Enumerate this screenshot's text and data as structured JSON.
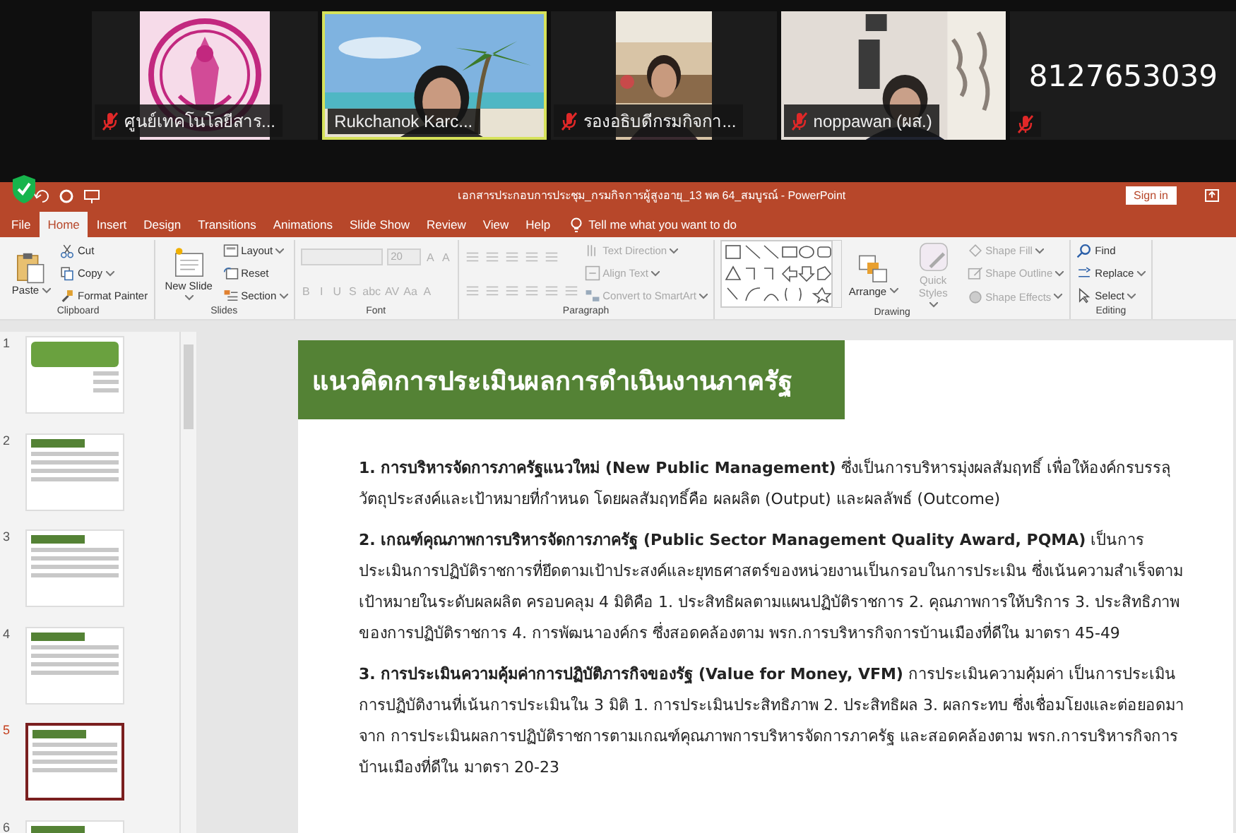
{
  "meeting": {
    "participants": [
      {
        "kind": "logo",
        "name": "ศูนย์เทคโนโลยีสาร...",
        "muted": true,
        "selected": false
      },
      {
        "kind": "video",
        "name": "Rukchanok Karc...",
        "muted": false,
        "selected": true
      },
      {
        "kind": "video",
        "name": "รองอธิบดีกรมกิจกา...",
        "muted": true,
        "selected": false
      },
      {
        "kind": "video",
        "name": "noppawan (ผส.)",
        "muted": true,
        "selected": false
      },
      {
        "kind": "number",
        "name": "8127653039",
        "muted": true,
        "selected": false
      }
    ]
  },
  "powerpoint": {
    "window": {
      "title": "เอกสารประกอบการประชุม_กรมกิจการผู้สูงอายุ_13 พค 64_สมบูรณ์  -  PowerPoint",
      "sign_in": "Sign in"
    },
    "tabs": [
      {
        "label": "File",
        "selected": false
      },
      {
        "label": "Home",
        "selected": true
      },
      {
        "label": "Insert",
        "selected": false
      },
      {
        "label": "Design",
        "selected": false
      },
      {
        "label": "Transitions",
        "selected": false
      },
      {
        "label": "Animations",
        "selected": false
      },
      {
        "label": "Slide Show",
        "selected": false
      },
      {
        "label": "Review",
        "selected": false
      },
      {
        "label": "View",
        "selected": false
      },
      {
        "label": "Help",
        "selected": false
      }
    ],
    "tell_me": "Tell me what you want to do",
    "ribbon": [
      {
        "label": "Clipboard",
        "columns": [
          [
            [
              {
                "kind": "large",
                "label": "Paste",
                "menu": true,
                "disabled": false
              }
            ]
          ],
          [
            [
              {
                "kind": "small",
                "label": "Cut",
                "menu": false,
                "disabled": false
              }
            ],
            [
              {
                "kind": "small",
                "label": "Copy",
                "menu": true,
                "disabled": false
              }
            ],
            [
              {
                "kind": "small",
                "label": "Format Painter",
                "menu": false,
                "disabled": false
              }
            ]
          ]
        ]
      },
      {
        "label": "Slides",
        "columns": [
          [
            [
              {
                "kind": "large",
                "label": "New Slide",
                "menu": true,
                "disabled": false
              }
            ]
          ],
          [
            [
              {
                "kind": "small",
                "label": "Layout",
                "menu": true,
                "disabled": false
              }
            ],
            [
              {
                "kind": "small",
                "label": "Reset",
                "menu": false,
                "disabled": false
              }
            ],
            [
              {
                "kind": "small",
                "label": "Section",
                "menu": true,
                "disabled": false
              }
            ]
          ]
        ]
      },
      {
        "label": "Font",
        "columns": [
          [
            [
              {
                "kind": "field",
                "disabled": true
              },
              {
                "kind": "field",
                "value": "20",
                "disabled": true
              },
              {
                "kind": "glyph",
                "label": "A",
                "disabled": true
              },
              {
                "kind": "glyph",
                "label": "A",
                "disabled": true
              }
            ],
            [
              {
                "kind": "glyph",
                "label": "B",
                "disabled": true
              },
              {
                "kind": "glyph",
                "label": "I",
                "disabled": true
              },
              {
                "kind": "glyph",
                "label": "U",
                "disabled": true
              },
              {
                "kind": "glyph",
                "label": "S",
                "disabled": true
              },
              {
                "kind": "glyph",
                "label": "abc",
                "disabled": true
              },
              {
                "kind": "glyph",
                "label": "AV",
                "disabled": true
              },
              {
                "kind": "glyph",
                "label": "Aa",
                "disabled": true
              },
              {
                "kind": "glyph",
                "label": "A",
                "disabled": true
              }
            ]
          ]
        ]
      },
      {
        "label": "Paragraph",
        "columns": [
          [
            [
              {
                "kind": "icon",
                "disabled": true
              },
              {
                "kind": "icon",
                "disabled": true
              },
              {
                "kind": "icon",
                "disabled": true
              },
              {
                "kind": "icon",
                "disabled": true
              },
              {
                "kind": "icon",
                "disabled": true
              }
            ],
            [
              {
                "kind": "icon",
                "disabled": true
              },
              {
                "kind": "icon",
                "disabled": true
              },
              {
                "kind": "icon",
                "disabled": true
              },
              {
                "kind": "icon",
                "disabled": true
              },
              {
                "kind": "icon",
                "disabled": true
              },
              {
                "kind": "icon",
                "disabled": true
              }
            ]
          ],
          [
            [
              {
                "kind": "small",
                "label": "Text Direction",
                "menu": true,
                "disabled": true
              }
            ],
            [
              {
                "kind": "small",
                "label": "Align Text",
                "menu": true,
                "disabled": true
              }
            ],
            [
              {
                "kind": "small",
                "label": "Convert to SmartArt",
                "menu": true,
                "disabled": true
              }
            ]
          ]
        ]
      },
      {
        "label": "Drawing",
        "columns": [
          [
            [
              {
                "kind": "gallery",
                "disabled": false
              }
            ]
          ],
          [
            [
              {
                "kind": "large",
                "label": "Arrange",
                "menu": true,
                "disabled": false
              }
            ]
          ],
          [
            [
              {
                "kind": "large",
                "label": "Quick Styles",
                "menu": true,
                "disabled": true
              }
            ]
          ],
          [
            [
              {
                "kind": "small",
                "label": "Shape Fill",
                "menu": true,
                "disabled": true
              }
            ],
            [
              {
                "kind": "small",
                "label": "Shape Outline",
                "menu": true,
                "disabled": true
              }
            ],
            [
              {
                "kind": "small",
                "label": "Shape Effects",
                "menu": true,
                "disabled": true
              }
            ]
          ]
        ]
      },
      {
        "label": "Editing",
        "columns": [
          [
            [
              {
                "kind": "small",
                "label": "Find",
                "menu": false,
                "disabled": false
              }
            ],
            [
              {
                "kind": "small",
                "label": "Replace",
                "menu": true,
                "disabled": false
              }
            ],
            [
              {
                "kind": "small",
                "label": "Select",
                "menu": true,
                "disabled": false
              }
            ]
          ]
        ]
      }
    ],
    "slides": [
      {
        "number": "1",
        "kind": "title",
        "selected": false
      },
      {
        "number": "2",
        "kind": "content",
        "selected": false
      },
      {
        "number": "3",
        "kind": "content",
        "selected": false
      },
      {
        "number": "4",
        "kind": "content",
        "selected": false
      },
      {
        "number": "5",
        "kind": "content",
        "selected": true
      },
      {
        "number": "6",
        "kind": "content",
        "selected": false
      }
    ],
    "slide": {
      "title": "แนวคิดการประเมินผลการดำเนินงานภาครัฐ",
      "paragraphs": [
        "**1. การบริหารจัดการภาครัฐแนวใหม่ (New Public Management)** ซึ่งเป็นการบริหารมุ่งผลสัมฤทธิ์ เพื่อให้องค์กรบรรลุวัตถุประสงค์และเป้าหมายที่กำหนด โดยผลสัมฤทธิ์คือ ผลผลิต (Output) และผลลัพธ์ (Outcome)",
        "**2. เกณฑ์คุณภาพการบริหารจัดการภาครัฐ (Public Sector Management Quality Award, PQMA)** เป็นการประเมินการปฏิบัติราชการที่ยึดตามเป้าประสงค์และยุทธศาสตร์ของหน่วยงานเป็นกรอบในการประเมิน ซึ่งเน้นความสำเร็จตามเป้าหมายในระดับผลผลิต ครอบคลุม 4 มิติคือ 1. ประสิทธิผลตามแผนปฏิบัติราชการ 2. คุณภาพการให้บริการ 3. ประสิทธิภาพของการปฏิบัติราชการ 4. การพัฒนาองค์กร ซึ่งสอดคล้องตาม พรก.การบริหารกิจการบ้านเมืองที่ดีใน มาตรา 45-49",
        "**3. การประเมินความคุ้มค่าการปฏิบัติภารกิจของรัฐ (Value for Money, VFM)** การประเมินความคุ้มค่า เป็นการประเมินการปฏิบัติงานที่เน้นการประเมินใน 3 มิติ 1. การประเมินประสิทธิภาพ 2. ประสิทธิผล 3. ผลกระทบ ซึ่งเชื่อมโยงและต่อยอดมาจาก การประเมินผลการปฏิบัติราชการตามเกณฑ์คุณภาพการบริหารจัดการภาครัฐ และสอดคล้องตาม พรก.การบริหารกิจการบ้านเมืองที่ดีใน มาตรา 20-23"
      ]
    }
  }
}
